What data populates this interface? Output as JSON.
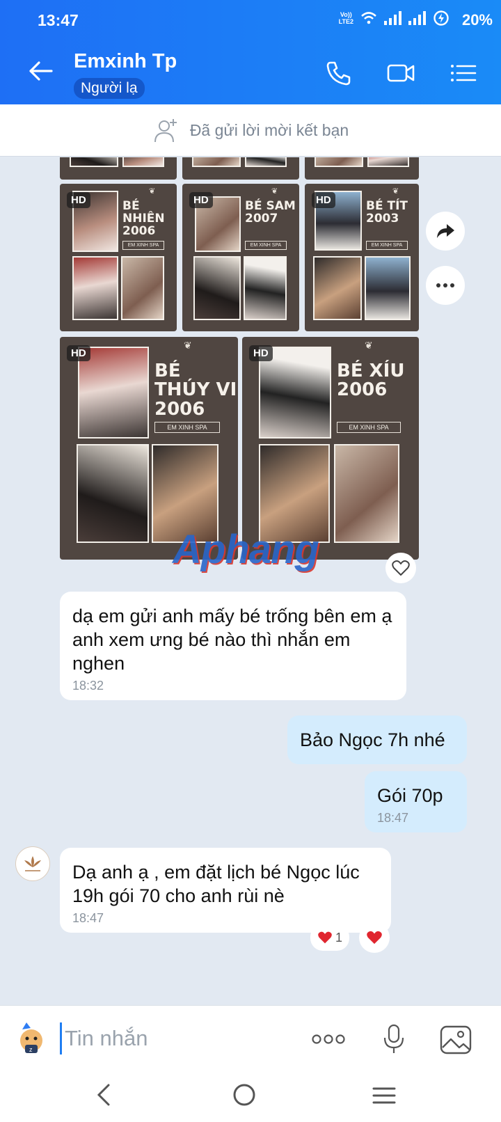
{
  "status": {
    "time": "13:47",
    "network": "LTE2",
    "battery": "20%"
  },
  "header": {
    "title": "Emxinh Tp",
    "badge": "Người lạ"
  },
  "friend_bar": {
    "text": "Đã gửi lời mời kết bạn"
  },
  "images": {
    "hd": "HD",
    "tiles": [
      {
        "name": "BÉ NHIÊN",
        "year": "2006",
        "tag": "EM XINH SPA"
      },
      {
        "name": "BÉ SAM",
        "year": "2007",
        "tag": "EM XINH SPA"
      },
      {
        "name": "BÉ TÍT",
        "year": "2003",
        "tag": "EM XINH SPA"
      },
      {
        "name": "BÉ THÚY VI",
        "year": "2006",
        "tag": "EM XINH SPA"
      },
      {
        "name": "BÉ XÍU",
        "year": "2006",
        "tag": "EM XINH SPA"
      }
    ],
    "watermark": "Aphang"
  },
  "messages": [
    {
      "from": "them",
      "text": "dạ em gửi anh mấy bé trống bên em ạ anh xem ưng bé nào thì nhắn em nghen",
      "time": "18:32"
    },
    {
      "from": "me",
      "text": "Bảo Ngọc 7h nhé"
    },
    {
      "from": "me",
      "text": "Gói 70p",
      "time": "18:47"
    },
    {
      "from": "them",
      "text": "Dạ anh ạ , em đặt lịch bé Ngọc lúc 19h gói 70 cho anh rùi nè",
      "time": "18:47",
      "reaction_count": "1"
    }
  ],
  "input": {
    "placeholder": "Tin nhắn"
  },
  "colors": {
    "header": "#1e6ff5",
    "my_bubble": "#d4ecfd",
    "their_bubble": "#ffffff",
    "chat_bg": "#e2e9f2"
  }
}
